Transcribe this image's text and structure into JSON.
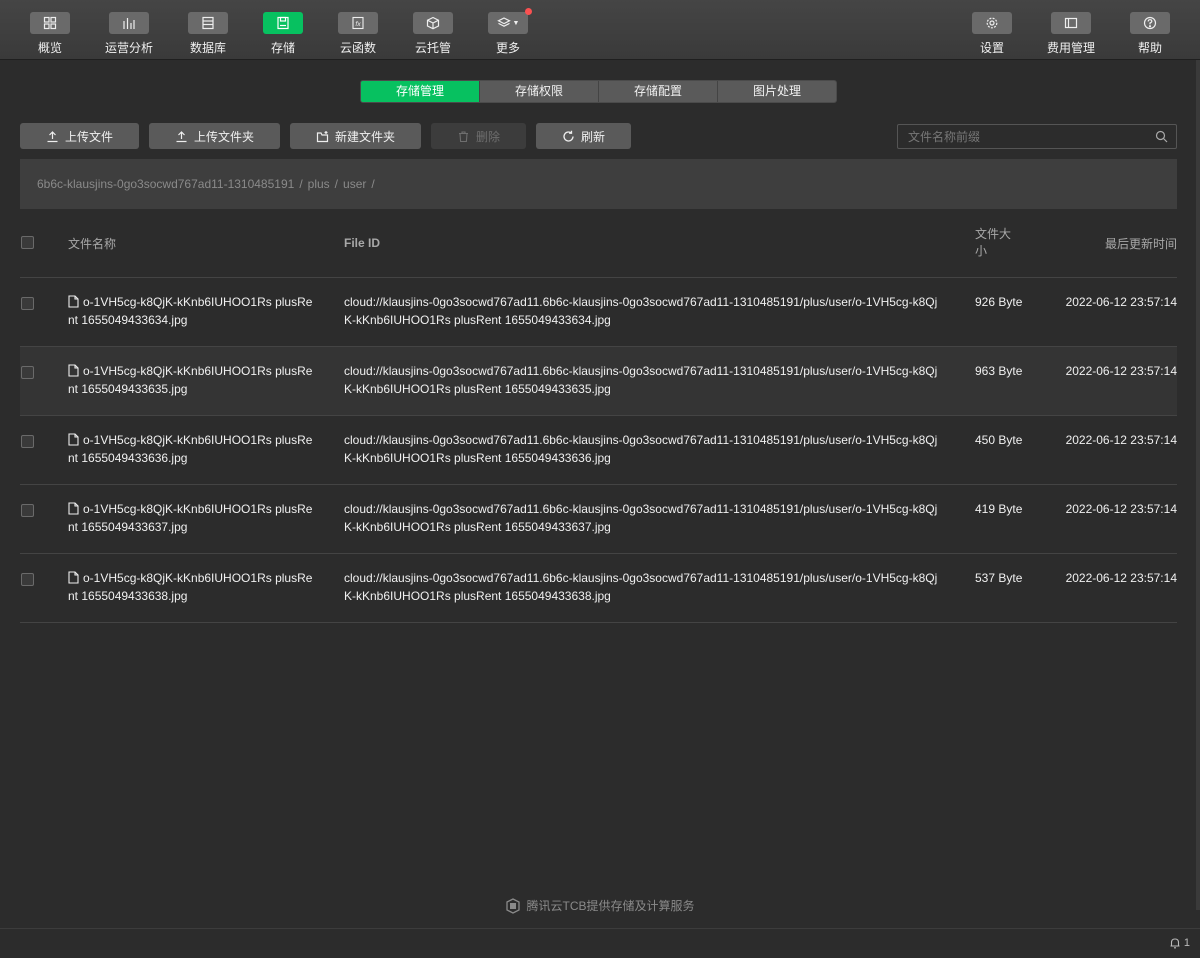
{
  "toolbar": {
    "left": [
      {
        "label": "概览",
        "icon": "grid-icon"
      },
      {
        "label": "运营分析",
        "icon": "bar-chart-icon"
      },
      {
        "label": "数据库",
        "icon": "database-icon"
      },
      {
        "label": "存储",
        "icon": "storage-icon",
        "active": true
      },
      {
        "label": "云函数",
        "icon": "function-icon"
      },
      {
        "label": "云托管",
        "icon": "cube-icon"
      },
      {
        "label": "更多",
        "icon": "layers-icon"
      }
    ],
    "right": [
      {
        "label": "设置",
        "icon": "gear-icon"
      },
      {
        "label": "费用管理",
        "icon": "billing-icon"
      },
      {
        "label": "帮助",
        "icon": "help-icon"
      }
    ]
  },
  "tabs": [
    "存储管理",
    "存储权限",
    "存储配置",
    "图片处理"
  ],
  "actions": {
    "upload_file": "上传文件",
    "upload_folder": "上传文件夹",
    "new_folder": "新建文件夹",
    "delete": "删除",
    "refresh": "刷新"
  },
  "search": {
    "placeholder": "文件名称前缀"
  },
  "breadcrumb": [
    "6b6c-klausjins-0go3socwd767ad11-1310485191",
    "plus",
    "user"
  ],
  "table": {
    "headers": {
      "name": "文件名称",
      "file_id": "File ID",
      "size": "文件大小",
      "updated": "最后更新时间"
    },
    "rows": [
      {
        "name": "o-1VH5cg-k8QjK-kKnb6IUHOO1Rs plusRent 1655049433634.jpg",
        "file_id": "cloud://klausjins-0go3socwd767ad11.6b6c-klausjins-0go3socwd767ad11-1310485191/plus/user/o-1VH5cg-k8QjK-kKnb6IUHOO1Rs plusRent 1655049433634.jpg",
        "size": "926 Byte",
        "updated": "2022-06-12 23:57:14"
      },
      {
        "name": "o-1VH5cg-k8QjK-kKnb6IUHOO1Rs plusRent 1655049433635.jpg",
        "file_id": "cloud://klausjins-0go3socwd767ad11.6b6c-klausjins-0go3socwd767ad11-1310485191/plus/user/o-1VH5cg-k8QjK-kKnb6IUHOO1Rs plusRent 1655049433635.jpg",
        "size": "963 Byte",
        "updated": "2022-06-12 23:57:14"
      },
      {
        "name": "o-1VH5cg-k8QjK-kKnb6IUHOO1Rs plusRent 1655049433636.jpg",
        "file_id": "cloud://klausjins-0go3socwd767ad11.6b6c-klausjins-0go3socwd767ad11-1310485191/plus/user/o-1VH5cg-k8QjK-kKnb6IUHOO1Rs plusRent 1655049433636.jpg",
        "size": "450 Byte",
        "updated": "2022-06-12 23:57:14"
      },
      {
        "name": "o-1VH5cg-k8QjK-kKnb6IUHOO1Rs plusRent 1655049433637.jpg",
        "file_id": "cloud://klausjins-0go3socwd767ad11.6b6c-klausjins-0go3socwd767ad11-1310485191/plus/user/o-1VH5cg-k8QjK-kKnb6IUHOO1Rs plusRent 1655049433637.jpg",
        "size": "419 Byte",
        "updated": "2022-06-12 23:57:14"
      },
      {
        "name": "o-1VH5cg-k8QjK-kKnb6IUHOO1Rs plusRent 1655049433638.jpg",
        "file_id": "cloud://klausjins-0go3socwd767ad11.6b6c-klausjins-0go3socwd767ad11-1310485191/plus/user/o-1VH5cg-k8QjK-kKnb6IUHOO1Rs plusRent 1655049433638.jpg",
        "size": "537 Byte",
        "updated": "2022-06-12 23:57:14"
      }
    ]
  },
  "footer": {
    "brand": "腾讯云TCB提供存储及计算服务",
    "notification_count": "1"
  },
  "colors": {
    "accent": "#07c160",
    "background": "#2c2c2c",
    "badge": "#fa5151"
  }
}
